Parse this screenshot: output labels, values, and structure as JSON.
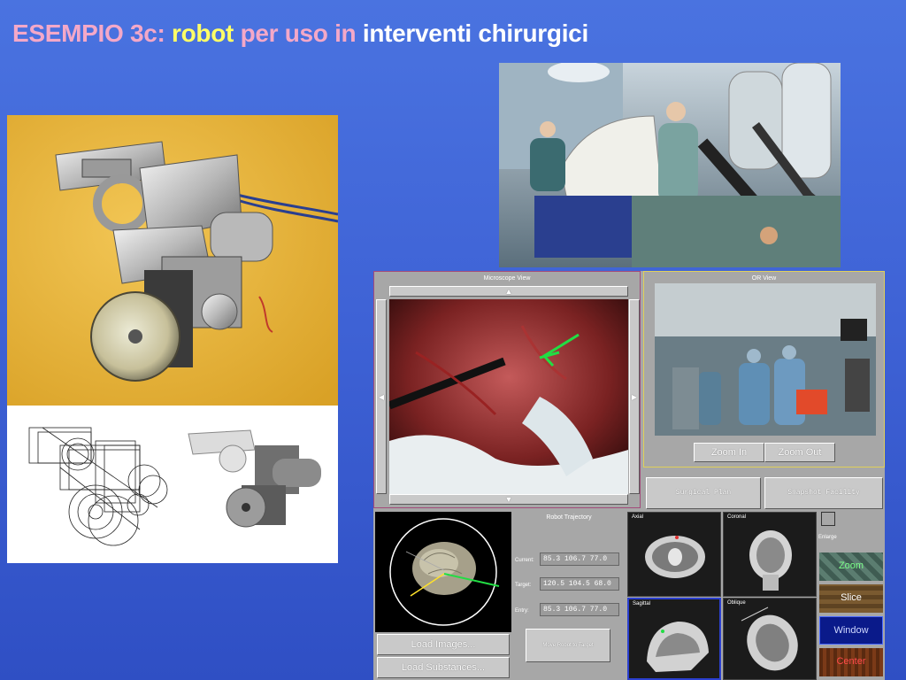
{
  "slide": {
    "title_part1": "ESEMPIO 3c:",
    "title_part2": "robot",
    "title_part3": "per uso in",
    "title_part4": "interventi chirurgici"
  },
  "colors": {
    "background": "#3f63d6",
    "title_pink": "#f4a8c8",
    "title_yellow": "#ffff66",
    "title_white": "#ffffff"
  },
  "software": {
    "microscope_view_label": "Microscope View",
    "or_view_label": "OR View",
    "zoom_in_label": "Zoom In",
    "zoom_out_label": "Zoom Out",
    "surgical_plan_label": "Surgical Plan",
    "snapshot_facility_label": "Snapshot Facility",
    "robot_trajectory_label": "Robot Trajectory",
    "current_label": "Current:",
    "target_label": "Target:",
    "entry_label": "Entry:",
    "current_value": "85.3 106.7 77.0",
    "target_value": "120.5 104.5 68.0",
    "entry_value": "85.3 106.7 77.0",
    "move_robot_label": "Move Robot to Target",
    "load_images_label": "Load Images...",
    "load_substances_label": "Load Substances...",
    "axial_label": "Axial",
    "coronal_label": "Coronal",
    "sagittal_label": "Sagittal",
    "oblique_label": "Oblique",
    "enlarge_label": "Enlarge",
    "zoom_label": "Zoom",
    "slice_label": "Slice",
    "window_label": "Window",
    "center_label": "Center",
    "up_arrow": "▲",
    "down_arrow": "▼",
    "left_arrow": "◀",
    "right_arrow": "▶"
  }
}
